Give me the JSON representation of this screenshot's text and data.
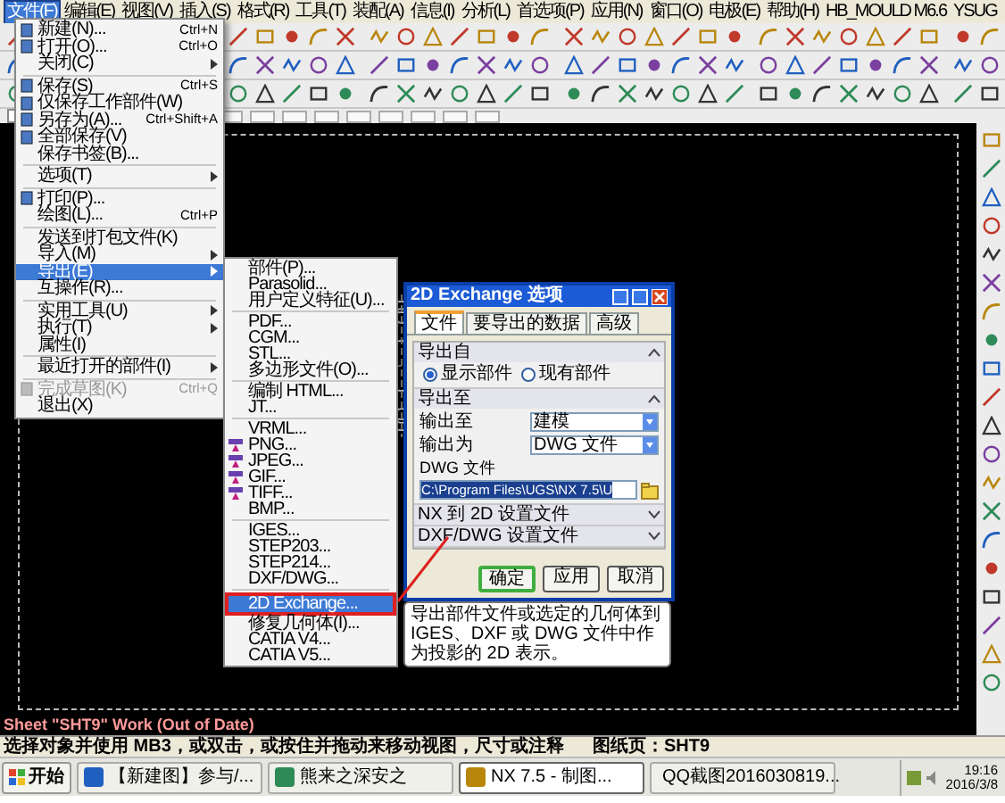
{
  "menu_bar": [
    {
      "label": "文件(F)",
      "selected": true
    },
    {
      "label": "编辑(E)",
      "selected": false
    },
    {
      "label": "视图(V)",
      "selected": false
    },
    {
      "label": "插入(S)",
      "selected": false
    },
    {
      "label": "格式(R)",
      "selected": false
    },
    {
      "label": "工具(T)",
      "selected": false
    },
    {
      "label": "装配(A)",
      "selected": false
    },
    {
      "label": "信息(I)",
      "selected": false
    },
    {
      "label": "分析(L)",
      "selected": false
    },
    {
      "label": "首选项(P)",
      "selected": false
    },
    {
      "label": "应用(N)",
      "selected": false
    },
    {
      "label": "窗口(O)",
      "selected": false
    },
    {
      "label": "电极(E)",
      "selected": false
    },
    {
      "label": "帮助(H)",
      "selected": false
    },
    {
      "label": "HB_MOULD M6.6",
      "selected": false
    },
    {
      "label": "YSUG",
      "selected": false
    }
  ],
  "file_menu": [
    {
      "kind": "item",
      "label": "新建(N)...",
      "shortcut": "Ctrl+N",
      "icon": true,
      "submenu": false,
      "selected": false,
      "disabled": false
    },
    {
      "kind": "item",
      "label": "打开(O)...",
      "shortcut": "Ctrl+O",
      "icon": true,
      "submenu": false,
      "selected": false,
      "disabled": false
    },
    {
      "kind": "item",
      "label": "关闭(C)",
      "icon": false,
      "submenu": true,
      "selected": false,
      "disabled": false
    },
    {
      "kind": "separator"
    },
    {
      "kind": "item",
      "label": "保存(S)",
      "shortcut": "Ctrl+S",
      "icon": true,
      "submenu": false,
      "selected": false,
      "disabled": false
    },
    {
      "kind": "item",
      "label": "仅保存工作部件(W)",
      "icon": true,
      "submenu": false,
      "selected": false,
      "disabled": false
    },
    {
      "kind": "item",
      "label": "另存为(A)...",
      "shortcut": "Ctrl+Shift+A",
      "icon": true,
      "submenu": false,
      "selected": false,
      "disabled": false
    },
    {
      "kind": "item",
      "label": "全部保存(V)",
      "icon": true,
      "submenu": false,
      "selected": false,
      "disabled": false
    },
    {
      "kind": "item",
      "label": "保存书签(B)...",
      "icon": false,
      "submenu": false,
      "selected": false,
      "disabled": false
    },
    {
      "kind": "separator"
    },
    {
      "kind": "item",
      "label": "选项(T)",
      "icon": false,
      "submenu": true,
      "selected": false,
      "disabled": false
    },
    {
      "kind": "separator"
    },
    {
      "kind": "item",
      "label": "打印(P)...",
      "icon": true,
      "submenu": false,
      "selected": false,
      "disabled": false
    },
    {
      "kind": "item",
      "label": "绘图(L)...",
      "shortcut": "Ctrl+P",
      "icon": false,
      "submenu": false,
      "selected": false,
      "disabled": false
    },
    {
      "kind": "separator"
    },
    {
      "kind": "item",
      "label": "发送到打包文件(K)",
      "icon": false,
      "submenu": false,
      "selected": false,
      "disabled": false
    },
    {
      "kind": "item",
      "label": "导入(M)",
      "icon": false,
      "submenu": true,
      "selected": false,
      "disabled": false
    },
    {
      "kind": "item",
      "label": "导出(E)",
      "icon": false,
      "submenu": true,
      "selected": true,
      "disabled": false
    },
    {
      "kind": "item",
      "label": "互操作(R)...",
      "icon": false,
      "submenu": false,
      "selected": false,
      "disabled": false
    },
    {
      "kind": "separator"
    },
    {
      "kind": "item",
      "label": "实用工具(U)",
      "icon": false,
      "submenu": true,
      "selected": false,
      "disabled": false
    },
    {
      "kind": "item",
      "label": "执行(T)",
      "icon": false,
      "submenu": true,
      "selected": false,
      "disabled": false
    },
    {
      "kind": "item",
      "label": "属性(I)",
      "icon": false,
      "submenu": false,
      "selected": false,
      "disabled": false
    },
    {
      "kind": "separator"
    },
    {
      "kind": "item",
      "label": "最近打开的部件(I)",
      "icon": false,
      "submenu": true,
      "selected": false,
      "disabled": false
    },
    {
      "kind": "separator"
    },
    {
      "kind": "item",
      "label": "完成草图(K)",
      "shortcut": "Ctrl+Q",
      "icon": true,
      "submenu": false,
      "selected": false,
      "disabled": true
    },
    {
      "kind": "item",
      "label": "退出(X)",
      "icon": false,
      "submenu": false,
      "selected": false,
      "disabled": false
    }
  ],
  "export_menu": [
    {
      "kind": "item",
      "label": "部件(P)...",
      "icon": false,
      "selected": false
    },
    {
      "kind": "item",
      "label": "Parasolid...",
      "icon": false,
      "selected": false
    },
    {
      "kind": "item",
      "label": "用户定义特征(U)...",
      "icon": false,
      "selected": false
    },
    {
      "kind": "separator"
    },
    {
      "kind": "item",
      "label": "PDF...",
      "icon": false,
      "selected": false
    },
    {
      "kind": "item",
      "label": "CGM...",
      "icon": false,
      "selected": false
    },
    {
      "kind": "item",
      "label": "STL...",
      "icon": false,
      "selected": false
    },
    {
      "kind": "item",
      "label": "多边形文件(O)...",
      "icon": false,
      "selected": false
    },
    {
      "kind": "separator"
    },
    {
      "kind": "item",
      "label": "编制 HTML...",
      "icon": false,
      "selected": false
    },
    {
      "kind": "item",
      "label": "JT...",
      "icon": false,
      "selected": false
    },
    {
      "kind": "separator"
    },
    {
      "kind": "item",
      "label": "VRML...",
      "icon": false,
      "selected": false
    },
    {
      "kind": "item",
      "label": "PNG...",
      "icon": true,
      "selected": false
    },
    {
      "kind": "item",
      "label": "JPEG...",
      "icon": true,
      "selected": false
    },
    {
      "kind": "item",
      "label": "GIF...",
      "icon": true,
      "selected": false
    },
    {
      "kind": "item",
      "label": "TIFF...",
      "icon": true,
      "selected": false
    },
    {
      "kind": "item",
      "label": "BMP...",
      "icon": false,
      "selected": false
    },
    {
      "kind": "separator"
    },
    {
      "kind": "item",
      "label": "IGES...",
      "icon": false,
      "selected": false
    },
    {
      "kind": "item",
      "label": "STEP203...",
      "icon": false,
      "selected": false
    },
    {
      "kind": "item",
      "label": "STEP214...",
      "icon": false,
      "selected": false
    },
    {
      "kind": "item",
      "label": "DXF/DWG...",
      "icon": false,
      "selected": false
    },
    {
      "kind": "separator"
    },
    {
      "kind": "item",
      "label": "2D Exchange...",
      "icon": false,
      "selected": true
    },
    {
      "kind": "item",
      "label": "修复几何体(I)...",
      "icon": false,
      "selected": false
    },
    {
      "kind": "item",
      "label": "CATIA V4...",
      "icon": false,
      "selected": false
    },
    {
      "kind": "item",
      "label": "CATIA V5...",
      "icon": false,
      "selected": false
    }
  ],
  "tooltip": "导出部件文件或选定的几何体到 IGES、DXF 或 DWG 文件中作为投影的 2D 表示。",
  "dialog": {
    "title": "2D Exchange 选项",
    "tabs": [
      {
        "label": "文件",
        "selected": true
      },
      {
        "label": "要导出的数据",
        "selected": false
      },
      {
        "label": "高级",
        "selected": false
      }
    ],
    "sections": [
      {
        "kind": "radios",
        "title": "导出自",
        "expanded": true,
        "options": [
          {
            "label": "显示部件",
            "selected": true
          },
          {
            "label": "现有部件",
            "selected": false
          }
        ]
      },
      {
        "kind": "fields",
        "title": "导出至",
        "expanded": true,
        "rows": [
          {
            "label": "输出至",
            "value": "建模"
          },
          {
            "label": "输出为",
            "value": "DWG 文件"
          }
        ],
        "file_label": "DWG 文件",
        "file_path": "C:\\Program Files\\UGS\\NX 7.5\\U"
      },
      {
        "title": "NX 到 2D 设置文件",
        "expanded": false
      },
      {
        "title": "DXF/DWG 设置文件",
        "expanded": false
      }
    ],
    "buttons": [
      {
        "label": "确定",
        "default": true
      },
      {
        "label": "应用",
        "default": false
      },
      {
        "label": "取消",
        "default": false
      }
    ]
  },
  "canvas": {
    "sheet_label": "Sheet \"SHT9\" Work (Out of Date)"
  },
  "status_bar": {
    "prompt": "选择对象并使用 MB3，或双击，或按住并拖动来移动视图，尺寸或注释",
    "sheet": "图纸页：SHT9"
  },
  "taskbar": {
    "start": "开始",
    "tasks": [
      {
        "label": "【新建图】参与/...",
        "selected": false
      },
      {
        "label": "熊来之深安之",
        "selected": false
      },
      {
        "label": "NX 7.5 - 制图...",
        "selected": true
      },
      {
        "label": "QQ截图2016030819...",
        "selected": false
      }
    ],
    "time": "19:16",
    "date": "2016/3/8"
  }
}
